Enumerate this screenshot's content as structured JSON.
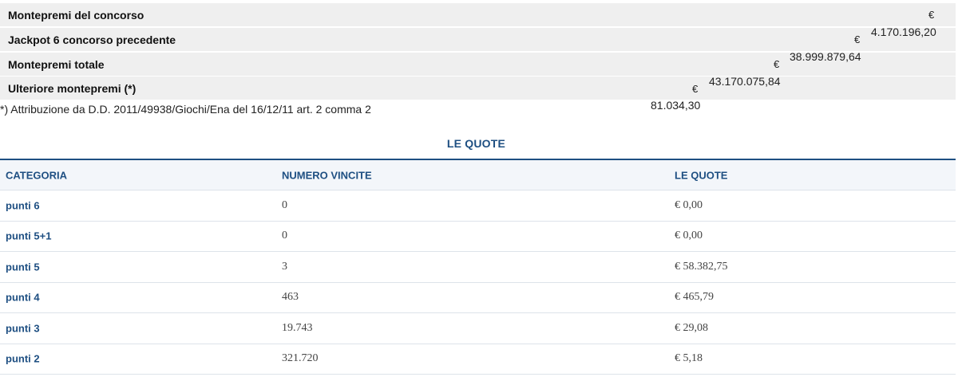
{
  "prizes": {
    "rows": [
      {
        "label": "Montepremi del concorso",
        "currency": "€"
      },
      {
        "label": "Jackpot 6 concorso precedente",
        "currency": "€",
        "amount": "4.170.196,20"
      },
      {
        "label": "Montepremi totale",
        "currency": "€",
        "amount": "38.999.879,64"
      },
      {
        "label": "Ulteriore montepremi (*)",
        "currency": "€",
        "amount": "43.170.075,84"
      }
    ],
    "footnote": "*) Attribuzione da D.D. 2011/49938/Giochi/Ena del 16/12/11 art. 2 comma 2",
    "footnote_amount": "81.034,30"
  },
  "quotes": {
    "title": "LE QUOTE",
    "headers": [
      "CATEGORIA",
      "NUMERO VINCITE",
      "LE QUOTE"
    ],
    "rows": [
      {
        "category": "punti 6",
        "winners": "0",
        "quota": "€ 0,00"
      },
      {
        "category": "punti 5+1",
        "winners": "0",
        "quota": "€ 0,00"
      },
      {
        "category": "punti 5",
        "winners": "3",
        "quota": "€ 58.382,75"
      },
      {
        "category": "punti 4",
        "winners": "463",
        "quota": "€ 465,79"
      },
      {
        "category": "punti 3",
        "winners": "19.743",
        "quota": "€ 29,08"
      },
      {
        "category": "punti 2",
        "winners": "321.720",
        "quota": "€ 5,18"
      }
    ]
  }
}
